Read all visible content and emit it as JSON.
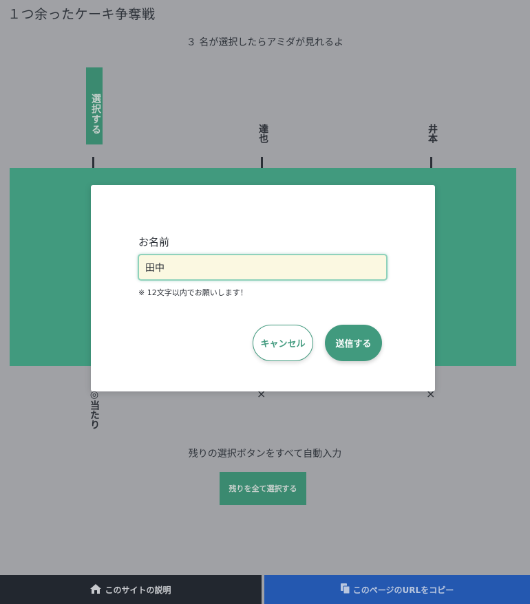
{
  "page": {
    "title": "１つ余ったケーキ争奪戦",
    "subtitle": "３ 名が選択したらアミダが見れるよ"
  },
  "players": [
    {
      "button_label": "選択する"
    },
    {
      "name": "達也"
    },
    {
      "name": "井本"
    }
  ],
  "results": [
    "◎当たり",
    "×",
    "×"
  ],
  "autofill": {
    "label": "残りの選択ボタンをすべて自動入力",
    "button_label": "残りを全て選択する"
  },
  "footer": {
    "about_label": "このサイトの説明",
    "copy_url_label": "このページのURLをコピー"
  },
  "modal": {
    "field_label": "お名前",
    "name_value": "田中",
    "hint": "※ 12文字以内でお願いします！",
    "cancel_label": "キャンセル",
    "submit_label": "送信する"
  },
  "colors": {
    "accent": "#419a7e",
    "overlay_bg": "#a0a1a5",
    "footer_dark": "#22272f",
    "footer_blue": "#2458b0"
  },
  "icons": {
    "about": "home-icon",
    "copy": "copy-icon"
  }
}
